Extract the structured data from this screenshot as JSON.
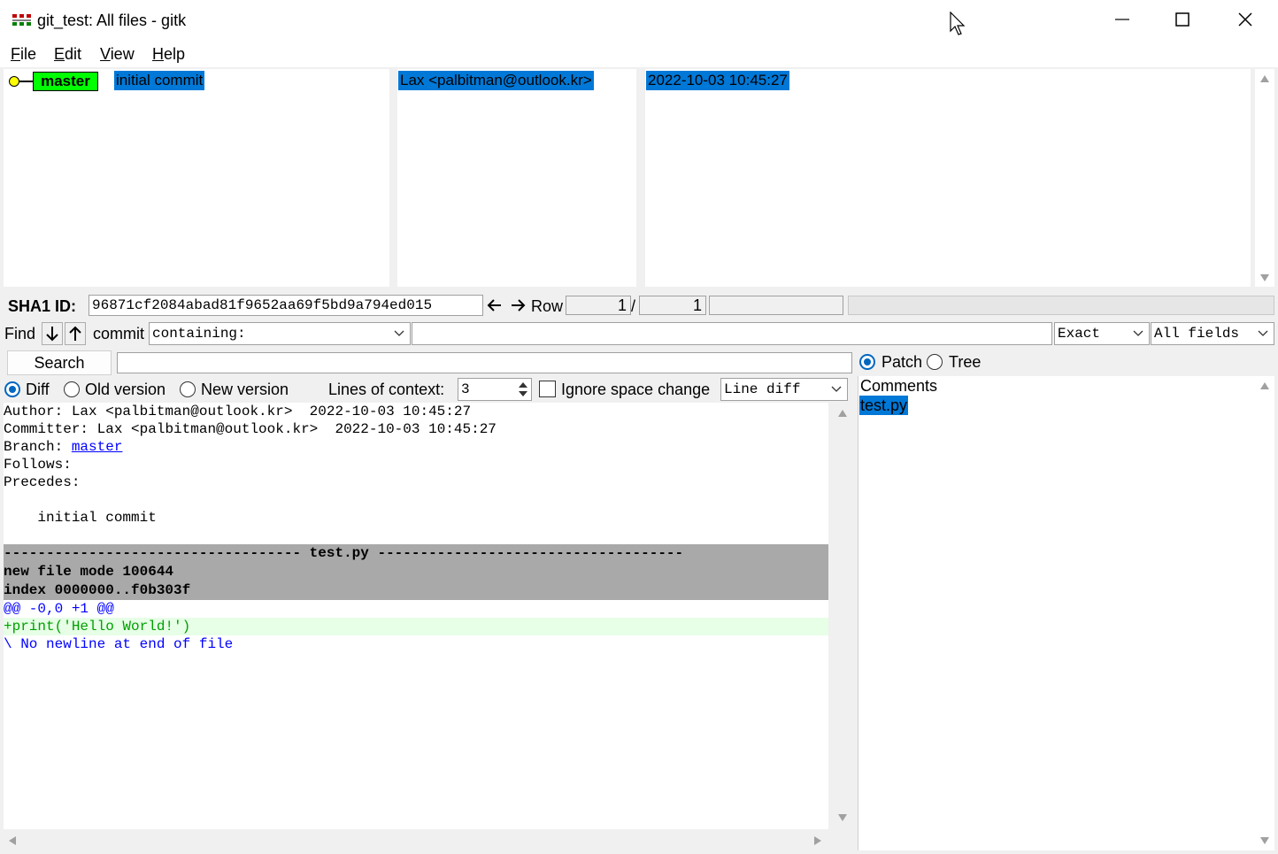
{
  "window": {
    "title": "git_test: All files - gitk"
  },
  "menu": {
    "items": [
      {
        "label": "File",
        "mnemonic": "F",
        "rest": "ile"
      },
      {
        "label": "Edit",
        "mnemonic": "E",
        "rest": "dit"
      },
      {
        "label": "View",
        "mnemonic": "V",
        "rest": "iew"
      },
      {
        "label": "Help",
        "mnemonic": "H",
        "rest": "elp"
      }
    ]
  },
  "commit_list": {
    "branch_tag": "master",
    "message": "initial commit",
    "author": "Lax <palbitman@outlook.kr>",
    "date": "2022-10-03 10:45:27"
  },
  "sha_bar": {
    "label": "SHA1 ID:",
    "sha": "96871cf2084abad81f9652aa69f5bd9a794ed015",
    "row_label": "Row",
    "row_current": "1",
    "row_separator": "/",
    "row_total": "1"
  },
  "find_bar": {
    "find_label": "Find",
    "commit_label": "commit",
    "containing_value": "containing:",
    "match_value": "Exact",
    "fields_value": "All fields",
    "search_button": "Search"
  },
  "diff_options": {
    "diff_label": "Diff",
    "old_version_label": "Old version",
    "new_version_label": "New version",
    "context_label": "Lines of context:",
    "context_value": "3",
    "ignore_space_label": "Ignore space change",
    "diff_mode_value": "Line diff",
    "selected": "Diff"
  },
  "details": {
    "author_prefix": "Author: ",
    "author_text": "Lax <palbitman@outlook.kr>  2022-10-03 10:45:27",
    "committer_prefix": "Committer: ",
    "committer_text": "Lax <palbitman@outlook.kr>  2022-10-03 10:45:27",
    "branch_prefix": "Branch: ",
    "branch_link": "master",
    "follows": "Follows:",
    "precedes": "Precedes:",
    "message": "    initial commit",
    "file_header": "----------------------------------- test.py ------------------------------------",
    "file_mode": "new file mode 100644",
    "index_line": "index 0000000..f0b303f",
    "hunk_header": "@@ -0,0 +1 @@",
    "added_line": "+print('Hello World!')",
    "no_newline": "\\ No newline at end of file"
  },
  "file_panel": {
    "patch_label": "Patch",
    "tree_label": "Tree",
    "selected": "Patch",
    "comments_label": "Comments",
    "files": [
      "test.py"
    ]
  },
  "colors": {
    "branch_tag_bg": "#00ff00",
    "selection_bg": "#0078d7",
    "file_header_bg": "#a9a9a9",
    "hunk_color": "#0000ff",
    "added_color": "#00a000",
    "added_bg": "#e6ffe6",
    "link_color": "#0000ff",
    "commit_dot": "#ffff00"
  }
}
